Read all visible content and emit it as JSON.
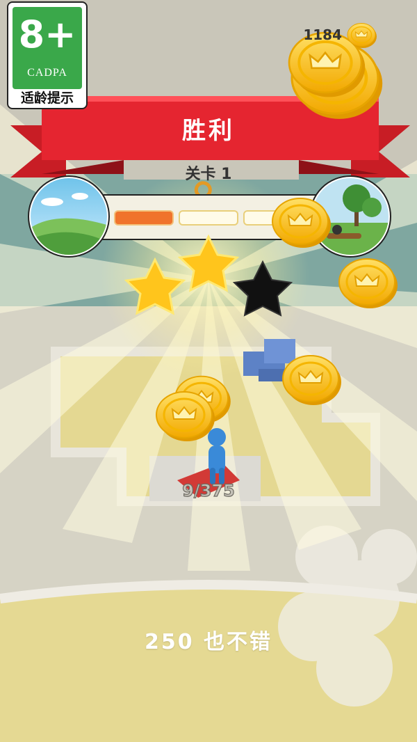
{
  "age_rating": {
    "number": "8+",
    "org": "CADPA",
    "tip": "适龄提示",
    "color": "#3aa84a"
  },
  "coins": {
    "count": "1184",
    "icon": "crown-coin-icon"
  },
  "victory": {
    "title": "胜利",
    "level_label": "关卡 1",
    "stars_earned": 2,
    "stars_total": 3,
    "progress_segments_filled": 1,
    "progress_segments_total": 3,
    "banner_color": "#e52530"
  },
  "board": {
    "counter_text": "9/375"
  },
  "result": {
    "score_line": "250  也不错"
  }
}
